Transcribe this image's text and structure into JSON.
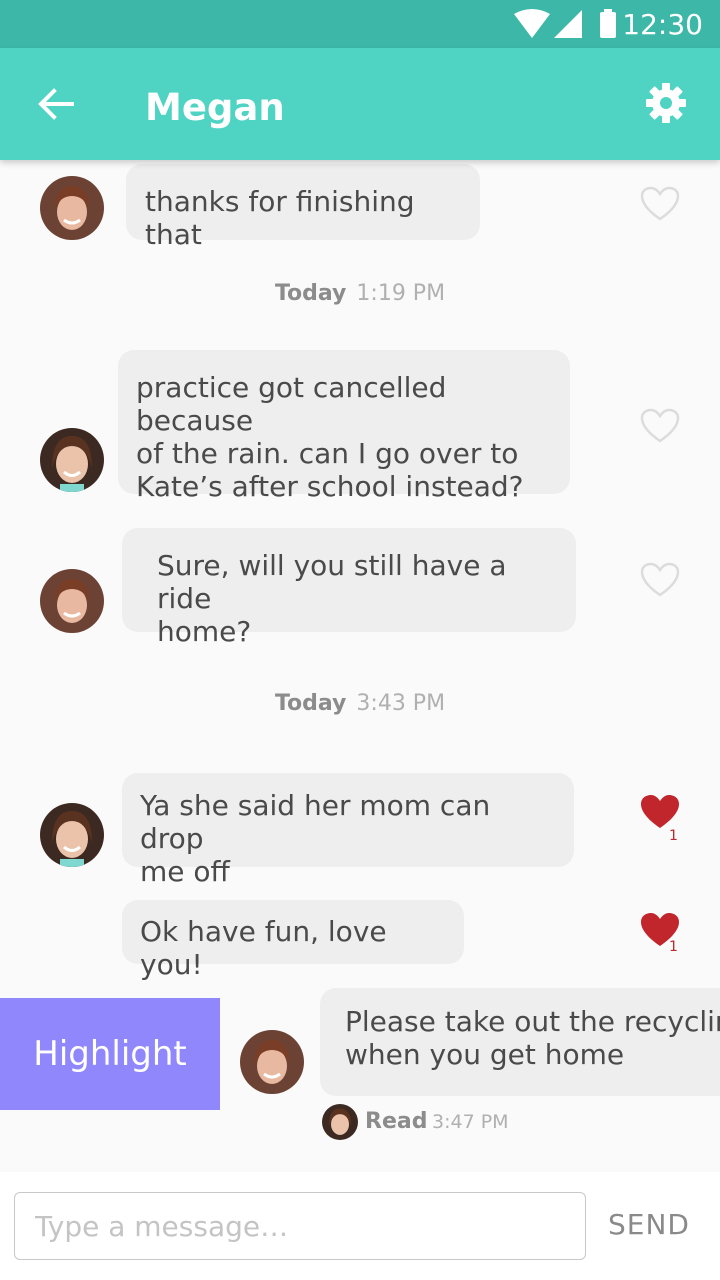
{
  "status": {
    "time": "12:30"
  },
  "header": {
    "title": "Megan"
  },
  "messages": [
    {
      "text": "thanks for finishing that"
    },
    {
      "text_lines": [
        "practice got cancelled because",
        "of the rain. can I go over to",
        "Kate’s after school instead?"
      ]
    },
    {
      "text_lines": [
        "Sure, will you still have a ride",
        "home?"
      ]
    },
    {
      "text_lines": [
        "Ya she said her mom can drop",
        "me off"
      ],
      "likes": "1"
    },
    {
      "text": "Ok have fun, love you!",
      "likes": "1"
    },
    {
      "text_lines": [
        "Please take out the recycling",
        "when you get home"
      ]
    }
  ],
  "separators": [
    {
      "day": "Today",
      "time": "1:19 PM"
    },
    {
      "day": "Today",
      "time": "3:43 PM"
    }
  ],
  "highlight": {
    "label": "Highlight"
  },
  "read_receipt": {
    "label": "Read",
    "time": "3:47 PM"
  },
  "composer": {
    "placeholder": "Type a message…",
    "send_label": "SEND"
  },
  "colors": {
    "status_bar": "#3db8a8",
    "app_bar": "#4fd3c3",
    "bubble": "#eeeeee",
    "heart_liked": "#c0262c",
    "heart_outline": "#dcdcdc",
    "highlight": "#8f87fb"
  },
  "icons": {
    "back": "arrow-left-icon",
    "settings": "gear-icon",
    "like": "heart-icon",
    "wifi": "wifi-icon",
    "signal": "signal-icon",
    "battery": "battery-icon"
  }
}
